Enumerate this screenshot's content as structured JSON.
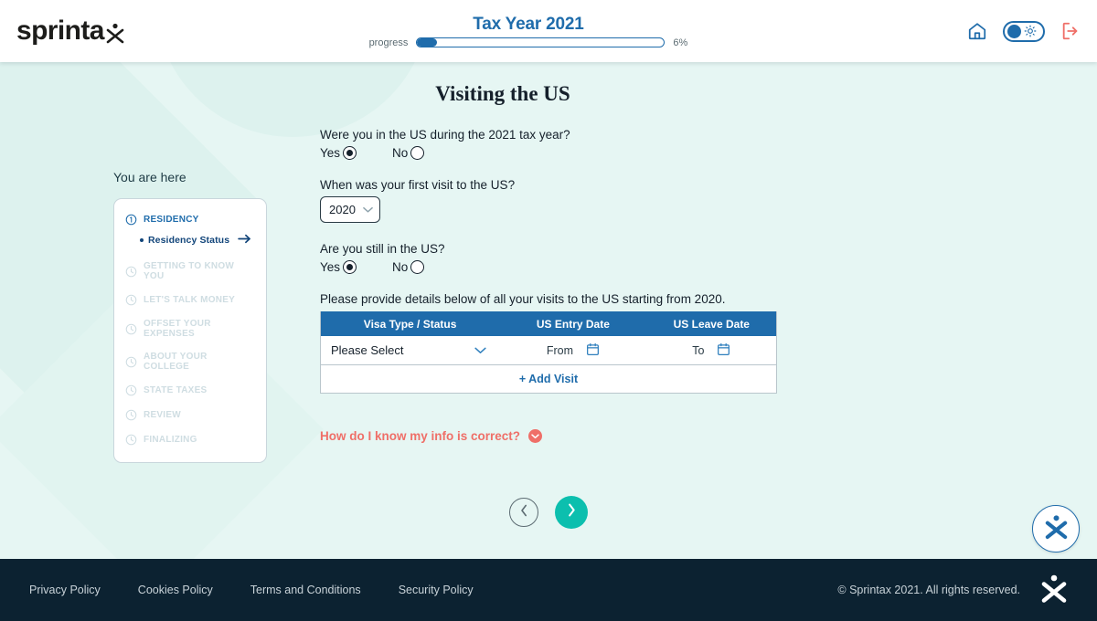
{
  "header": {
    "logo_text": "sprinta",
    "logo_icon": "sprintax-x-mark",
    "tax_year": "Tax Year 2021",
    "progress_label": "progress",
    "progress_percent_text": "6%",
    "progress_value": 6,
    "home_icon": "home-icon",
    "theme_toggle_icon": "sun-icon",
    "logout_icon": "logout-icon",
    "accent_blue": "#1f6cab",
    "logout_red": "#ef6f68"
  },
  "sidebar": {
    "heading": "You are here",
    "items": [
      {
        "label": "RESIDENCY",
        "icon": "number-one-circle-icon",
        "active": true
      },
      {
        "label": "GETTING TO KNOW YOU",
        "icon": "clock-icon",
        "active": false
      },
      {
        "label": "LET'S TALK MONEY",
        "icon": "clock-icon",
        "active": false
      },
      {
        "label": "OFFSET YOUR EXPENSES",
        "icon": "clock-icon",
        "active": false
      },
      {
        "label": "ABOUT YOUR COLLEGE",
        "icon": "clock-icon",
        "active": false
      },
      {
        "label": "STATE TAXES",
        "icon": "clock-icon",
        "active": false
      },
      {
        "label": "REVIEW",
        "icon": "clock-icon",
        "active": false
      },
      {
        "label": "FINALIZING",
        "icon": "clock-icon",
        "active": false
      }
    ],
    "substep": {
      "label": "Residency Status",
      "arrow_icon": "arrow-right-icon"
    }
  },
  "main": {
    "title": "Visiting the US",
    "q1": {
      "label": "Were you in the US during the 2021 tax year?",
      "yes_label": "Yes",
      "no_label": "No",
      "selected": "Yes"
    },
    "q2": {
      "label": "When was your first visit to the US?",
      "selected_year": "2020",
      "chevron_icon": "chevron-down-icon"
    },
    "q3": {
      "label": "Are you still in the US?",
      "yes_label": "Yes",
      "no_label": "No",
      "selected": "Yes"
    },
    "table": {
      "intro": "Please provide details below of all your visits to the US starting from 2020.",
      "columns": [
        "Visa Type / Status",
        "US Entry Date",
        "US Leave Date"
      ],
      "rows": [
        {
          "visa_type": "Please Select",
          "entry_placeholder": "From",
          "leave_placeholder": "To",
          "calendar_icon": "calendar-icon",
          "chevron_icon": "chevron-down-icon"
        }
      ],
      "add_row_label": "+ Add Visit",
      "header_color": "#1f6cab"
    },
    "help": {
      "label": "How do I know my info is correct?",
      "icon": "chevron-down-circle-icon",
      "color": "#ef6f68"
    },
    "nav": {
      "back_icon": "chevron-left-icon",
      "next_icon": "chevron-right-icon",
      "next_color": "#0cbfae"
    },
    "float_badge_icon": "sprintax-x-mark"
  },
  "footer": {
    "links": [
      "Privacy Policy",
      "Cookies Policy",
      "Terms and Conditions",
      "Security Policy"
    ],
    "copyright": "© Sprintax 2021. All rights reserved.",
    "logo_icon": "sprintax-x-mark",
    "background": "#0c2231"
  }
}
